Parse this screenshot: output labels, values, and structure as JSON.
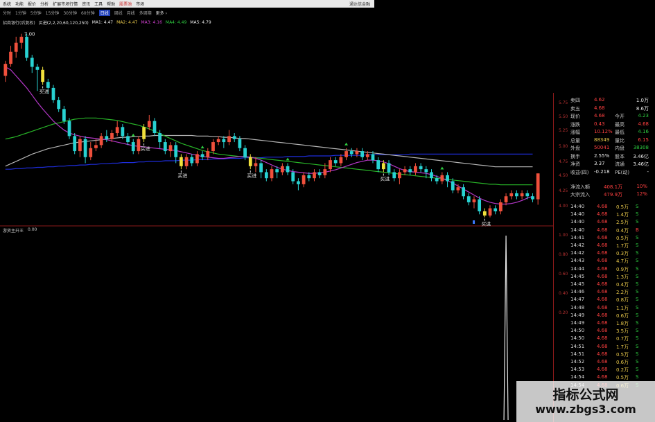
{
  "menu": {
    "items": [
      "系统",
      "功能",
      "报价",
      "分析",
      "扩展市场行情",
      "资讯",
      "工具",
      "帮助",
      "股票池",
      "市场"
    ],
    "hot_index": [
      8
    ],
    "app_name": "通达信金融"
  },
  "periods": {
    "items": [
      "分时",
      "1分钟",
      "5分钟",
      "15分钟",
      "30分钟",
      "60分钟",
      "日线",
      "周线",
      "月线",
      "多周期",
      "更多 ›"
    ],
    "active_index": 6
  },
  "legend": {
    "items": [
      {
        "text": "招商银行(后复权)",
        "color": "#c8c8c8"
      },
      {
        "text": "买进(2,2,20,60,120,250)",
        "color": "#e8e8e8"
      },
      {
        "text": "MA1: 4.47",
        "color": "#e8e8e8"
      },
      {
        "text": "MA2: 4.47",
        "color": "#e8c84a"
      },
      {
        "text": "MA3: 4.16",
        "color": "#d040d0"
      },
      {
        "text": "MA4: 4.49",
        "color": "#2ecc40"
      },
      {
        "text": "MA5: 4.79",
        "color": "#e8e8e8"
      }
    ]
  },
  "price_label": "7.00",
  "sub_indicator": {
    "name": "游资主升王",
    "value": "0.00"
  },
  "buy_label": "买进",
  "colors": {
    "up": "#f0503c",
    "down": "#28d2d2",
    "buy": "#f0e03c",
    "ma_purple": "#b437c8",
    "ma_green": "#28b428",
    "ma_white": "#b4b4b4",
    "ma_blue": "#1e2ddc"
  },
  "quote": [
    {
      "l1": "卖四",
      "v1": "4.62",
      "c1": "#ff4040",
      "l2": "",
      "v2": "1.0万",
      "c2": "#e8e8e8"
    },
    {
      "l1": "卖五",
      "v1": "4.68",
      "c1": "#ff4040",
      "l2": "",
      "v2": "8.6万",
      "c2": "#e8e8e8"
    },
    {
      "l1": "现价",
      "v1": "4.68",
      "c1": "#ff4040",
      "l2": "今开",
      "v2": "4.23",
      "c2": "#2ecc40"
    },
    {
      "l1": "涨跌",
      "v1": "0.43",
      "c1": "#ff4040",
      "l2": "最高",
      "v2": "4.68",
      "c2": "#ff4040"
    },
    {
      "l1": "涨幅",
      "v1": "10.12%",
      "c1": "#ff4040",
      "l2": "最低",
      "v2": "4.16",
      "c2": "#2ecc40"
    },
    {
      "l1": "总量",
      "v1": "88349",
      "c1": "#e8c84a",
      "l2": "量比",
      "v2": "6.15",
      "c2": "#ff4040"
    },
    {
      "l1": "外盘",
      "v1": "50041",
      "c1": "#ff4040",
      "l2": "内盘",
      "v2": "38308",
      "c2": "#2ecc40"
    },
    {
      "l1": "换手",
      "v1": "2.55%",
      "c1": "#e8e8e8",
      "l2": "股本",
      "v2": "3.46亿",
      "c2": "#e8e8e8"
    },
    {
      "l1": "净资",
      "v1": "3.37",
      "c1": "#e8e8e8",
      "l2": "流通",
      "v2": "3.46亿",
      "c2": "#e8e8e8"
    },
    {
      "l1": "收益(四)",
      "v1": "-0.218",
      "c1": "#e8e8e8",
      "l2": "PE(动)",
      "v2": "-",
      "c2": "#e8e8e8"
    }
  ],
  "flow": [
    {
      "l": "净流入额",
      "v": "408.1万",
      "p": "10%"
    },
    {
      "l": "大宗流入",
      "v": "479.9万",
      "p": "12%"
    }
  ],
  "right_axis": [
    "5.75",
    "5.50",
    "5.25",
    "5.00",
    "4.75",
    "4.50",
    "4.25",
    "4.00"
  ],
  "sub_axis": [
    "1.00",
    "0.80",
    "0.60",
    "0.40",
    "0.20"
  ],
  "ticks": [
    {
      "t": "14:40",
      "p": "4.68",
      "v": "0.5万",
      "s": "S"
    },
    {
      "t": "14:40",
      "p": "4.68",
      "v": "1.4万",
      "s": "S"
    },
    {
      "t": "14:40",
      "p": "4.68",
      "v": "2.5万",
      "s": "S"
    },
    {
      "t": "14:40",
      "p": "4.68",
      "v": "0.4万",
      "s": "B"
    },
    {
      "t": "14:41",
      "p": "4.68",
      "v": "0.5万",
      "s": "S"
    },
    {
      "t": "14:42",
      "p": "4.68",
      "v": "1.7万",
      "s": "S"
    },
    {
      "t": "14:42",
      "p": "4.68",
      "v": "0.3万",
      "s": "S"
    },
    {
      "t": "14:43",
      "p": "4.68",
      "v": "4.7万",
      "s": "S"
    },
    {
      "t": "14:44",
      "p": "4.68",
      "v": "0.9万",
      "s": "S"
    },
    {
      "t": "14:45",
      "p": "4.68",
      "v": "1.3万",
      "s": "S"
    },
    {
      "t": "14:45",
      "p": "4.68",
      "v": "0.4万",
      "s": "S"
    },
    {
      "t": "14:46",
      "p": "4.68",
      "v": "2.2万",
      "s": "S"
    },
    {
      "t": "14:47",
      "p": "4.68",
      "v": "0.8万",
      "s": "S"
    },
    {
      "t": "14:48",
      "p": "4.68",
      "v": "1.1万",
      "s": "S"
    },
    {
      "t": "14:49",
      "p": "4.68",
      "v": "0.6万",
      "s": "S"
    },
    {
      "t": "14:49",
      "p": "4.68",
      "v": "1.8万",
      "s": "S"
    },
    {
      "t": "14:50",
      "p": "4.68",
      "v": "3.5万",
      "s": "S"
    },
    {
      "t": "14:50",
      "p": "4.68",
      "v": "0.7万",
      "s": "S"
    },
    {
      "t": "14:51",
      "p": "4.68",
      "v": "1.7万",
      "s": "S"
    },
    {
      "t": "14:51",
      "p": "4.68",
      "v": "0.5万",
      "s": "S"
    },
    {
      "t": "14:52",
      "p": "4.68",
      "v": "0.6万",
      "s": "S"
    },
    {
      "t": "14:53",
      "p": "4.68",
      "v": "0.2万",
      "s": "S"
    },
    {
      "t": "14:54",
      "p": "4.68",
      "v": "0.5万",
      "s": "S"
    },
    {
      "t": "14:54",
      "p": "4.68",
      "v": "0.6万",
      "s": "S"
    }
  ],
  "chart_data": {
    "type": "candlestick",
    "y_axis_labels": [
      "5.75",
      "5.50",
      "5.25",
      "5.00",
      "4.75",
      "4.50",
      "4.25",
      "4.00"
    ],
    "ylim": [
      3.9,
      7.1
    ],
    "candles": [
      {
        "o": 6.3,
        "c": 6.5,
        "h": 6.55,
        "l": 6.2
      },
      {
        "o": 6.5,
        "c": 6.7,
        "h": 6.8,
        "l": 6.45
      },
      {
        "o": 6.7,
        "c": 6.85,
        "h": 6.95,
        "l": 6.6
      },
      {
        "o": 6.85,
        "c": 6.95,
        "h": 7.0,
        "l": 6.75
      },
      {
        "o": 6.95,
        "c": 6.6,
        "h": 7.0,
        "l": 6.55
      },
      {
        "o": 6.6,
        "c": 6.45,
        "h": 6.65,
        "l": 6.35
      },
      {
        "o": 6.45,
        "c": 6.4,
        "h": 6.5,
        "l": 6.05
      },
      {
        "o": 6.4,
        "c": 6.2,
        "h": 6.45,
        "l": 6.15
      },
      {
        "o": 6.2,
        "c": 6.1,
        "h": 6.25,
        "l": 6.0
      },
      {
        "o": 6.1,
        "c": 5.9,
        "h": 6.15,
        "l": 5.85
      },
      {
        "o": 5.9,
        "c": 5.75,
        "h": 5.95,
        "l": 5.7
      },
      {
        "o": 5.75,
        "c": 5.55,
        "h": 5.8,
        "l": 5.5
      },
      {
        "o": 5.55,
        "c": 5.3,
        "h": 5.6,
        "l": 5.25
      },
      {
        "o": 5.3,
        "c": 5.05,
        "h": 5.35,
        "l": 5.0
      },
      {
        "o": 5.05,
        "c": 5.25,
        "h": 5.3,
        "l": 4.95
      },
      {
        "o": 5.25,
        "c": 4.95,
        "h": 5.3,
        "l": 4.85
      },
      {
        "o": 4.95,
        "c": 5.1,
        "h": 5.2,
        "l": 4.9
      },
      {
        "o": 5.1,
        "c": 5.15,
        "h": 5.25,
        "l": 5.05
      },
      {
        "o": 5.15,
        "c": 5.3,
        "h": 5.35,
        "l": 5.1
      },
      {
        "o": 5.3,
        "c": 5.25,
        "h": 5.4,
        "l": 5.2
      },
      {
        "o": 5.25,
        "c": 5.35,
        "h": 5.4,
        "l": 5.2
      },
      {
        "o": 5.35,
        "c": 5.45,
        "h": 5.55,
        "l": 5.3
      },
      {
        "o": 5.45,
        "c": 5.3,
        "h": 5.5,
        "l": 5.25
      },
      {
        "o": 5.3,
        "c": 5.2,
        "h": 5.35,
        "l": 5.15
      },
      {
        "o": 5.2,
        "c": 5.05,
        "h": 5.25,
        "l": 5.0
      },
      {
        "o": 5.05,
        "c": 5.25,
        "h": 5.3,
        "l": 5.0
      },
      {
        "o": 5.25,
        "c": 5.45,
        "h": 5.5,
        "l": 5.2
      },
      {
        "o": 5.45,
        "c": 5.55,
        "h": 5.65,
        "l": 5.4
      },
      {
        "o": 5.55,
        "c": 5.35,
        "h": 5.6,
        "l": 5.3
      },
      {
        "o": 5.35,
        "c": 5.2,
        "h": 5.4,
        "l": 5.1
      },
      {
        "o": 5.2,
        "c": 5.05,
        "h": 5.25,
        "l": 5.0
      },
      {
        "o": 5.05,
        "c": 5.15,
        "h": 5.2,
        "l": 4.95
      },
      {
        "o": 5.15,
        "c": 4.95,
        "h": 5.2,
        "l": 4.85
      },
      {
        "o": 4.95,
        "c": 4.8,
        "h": 5.0,
        "l": 4.75
      },
      {
        "o": 4.8,
        "c": 4.95,
        "h": 5.0,
        "l": 4.75
      },
      {
        "o": 4.95,
        "c": 4.85,
        "h": 5.0,
        "l": 4.8
      },
      {
        "o": 4.85,
        "c": 5.0,
        "h": 5.05,
        "l": 4.8
      },
      {
        "o": 5.0,
        "c": 4.95,
        "h": 5.05,
        "l": 4.9
      },
      {
        "o": 4.95,
        "c": 5.05,
        "h": 5.1,
        "l": 4.9
      },
      {
        "o": 5.05,
        "c": 5.2,
        "h": 5.25,
        "l": 5.0
      },
      {
        "o": 5.2,
        "c": 5.25,
        "h": 5.3,
        "l": 5.15
      },
      {
        "o": 5.25,
        "c": 5.2,
        "h": 5.3,
        "l": 5.1
      },
      {
        "o": 5.2,
        "c": 5.3,
        "h": 5.4,
        "l": 5.15
      },
      {
        "o": 5.3,
        "c": 5.25,
        "h": 5.35,
        "l": 5.2
      },
      {
        "o": 5.25,
        "c": 5.1,
        "h": 5.3,
        "l": 5.05
      },
      {
        "o": 5.1,
        "c": 4.95,
        "h": 5.15,
        "l": 4.9
      },
      {
        "o": 4.95,
        "c": 4.8,
        "h": 5.0,
        "l": 4.75
      },
      {
        "o": 4.8,
        "c": 4.85,
        "h": 4.95,
        "l": 4.7
      },
      {
        "o": 4.85,
        "c": 4.7,
        "h": 4.9,
        "l": 4.6
      },
      {
        "o": 4.7,
        "c": 4.6,
        "h": 4.75,
        "l": 4.55
      },
      {
        "o": 4.6,
        "c": 4.75,
        "h": 4.8,
        "l": 4.55
      },
      {
        "o": 4.75,
        "c": 4.7,
        "h": 4.8,
        "l": 4.6
      },
      {
        "o": 4.7,
        "c": 4.8,
        "h": 4.85,
        "l": 4.65
      },
      {
        "o": 4.8,
        "c": 4.7,
        "h": 4.85,
        "l": 4.65
      },
      {
        "o": 4.7,
        "c": 4.55,
        "h": 4.75,
        "l": 4.5
      },
      {
        "o": 4.55,
        "c": 4.5,
        "h": 4.6,
        "l": 4.4
      },
      {
        "o": 4.5,
        "c": 4.65,
        "h": 4.7,
        "l": 4.45
      },
      {
        "o": 4.65,
        "c": 4.6,
        "h": 4.7,
        "l": 4.55
      },
      {
        "o": 4.6,
        "c": 4.7,
        "h": 4.75,
        "l": 4.55
      },
      {
        "o": 4.7,
        "c": 4.65,
        "h": 4.75,
        "l": 4.6
      },
      {
        "o": 4.65,
        "c": 4.75,
        "h": 4.85,
        "l": 4.6
      },
      {
        "o": 4.75,
        "c": 4.9,
        "h": 4.95,
        "l": 4.7
      },
      {
        "o": 4.9,
        "c": 4.85,
        "h": 4.95,
        "l": 4.8
      },
      {
        "o": 4.85,
        "c": 4.95,
        "h": 5.0,
        "l": 4.8
      },
      {
        "o": 4.95,
        "c": 5.05,
        "h": 5.1,
        "l": 4.9
      },
      {
        "o": 5.05,
        "c": 5.0,
        "h": 5.1,
        "l": 4.95
      },
      {
        "o": 5.0,
        "c": 5.05,
        "h": 5.1,
        "l": 4.95
      },
      {
        "o": 5.05,
        "c": 4.95,
        "h": 5.1,
        "l": 4.9
      },
      {
        "o": 4.95,
        "c": 5.0,
        "h": 5.05,
        "l": 4.9
      },
      {
        "o": 5.0,
        "c": 4.9,
        "h": 5.05,
        "l": 4.85
      },
      {
        "o": 4.9,
        "c": 4.75,
        "h": 4.95,
        "l": 4.7
      },
      {
        "o": 4.75,
        "c": 4.85,
        "h": 4.9,
        "l": 4.7
      },
      {
        "o": 4.85,
        "c": 4.7,
        "h": 4.9,
        "l": 4.65
      },
      {
        "o": 4.7,
        "c": 4.6,
        "h": 4.75,
        "l": 4.55
      },
      {
        "o": 4.6,
        "c": 4.7,
        "h": 4.75,
        "l": 4.5
      },
      {
        "o": 4.7,
        "c": 4.75,
        "h": 4.8,
        "l": 4.65
      },
      {
        "o": 4.75,
        "c": 4.7,
        "h": 4.8,
        "l": 4.65
      },
      {
        "o": 4.7,
        "c": 4.8,
        "h": 4.85,
        "l": 4.65
      },
      {
        "o": 4.8,
        "c": 4.75,
        "h": 4.85,
        "l": 4.7
      },
      {
        "o": 4.75,
        "c": 4.7,
        "h": 4.8,
        "l": 4.6
      },
      {
        "o": 4.7,
        "c": 4.6,
        "h": 4.75,
        "l": 4.55
      },
      {
        "o": 4.6,
        "c": 4.55,
        "h": 4.65,
        "l": 4.5
      },
      {
        "o": 4.55,
        "c": 4.65,
        "h": 4.7,
        "l": 4.5
      },
      {
        "o": 4.65,
        "c": 4.55,
        "h": 4.7,
        "l": 4.45
      },
      {
        "o": 4.55,
        "c": 4.4,
        "h": 4.6,
        "l": 4.35
      },
      {
        "o": 4.4,
        "c": 4.45,
        "h": 4.5,
        "l": 4.35
      },
      {
        "o": 4.45,
        "c": 4.3,
        "h": 4.5,
        "l": 4.25
      },
      {
        "o": 4.3,
        "c": 4.2,
        "h": 4.35,
        "l": 4.15
      },
      {
        "o": 4.2,
        "c": 4.25,
        "h": 4.3,
        "l": 4.1
      },
      {
        "o": 4.25,
        "c": 4.05,
        "h": 4.3,
        "l": 4.0
      },
      {
        "o": 4.05,
        "c": 3.98,
        "h": 4.1,
        "l": 3.95
      },
      {
        "o": 3.98,
        "c": 4.1,
        "h": 4.15,
        "l": 3.95
      },
      {
        "o": 4.1,
        "c": 4.05,
        "h": 4.15,
        "l": 4.0
      },
      {
        "o": 4.05,
        "c": 4.2,
        "h": 4.25,
        "l": 4.0
      },
      {
        "o": 4.2,
        "c": 4.3,
        "h": 4.35,
        "l": 4.15
      },
      {
        "o": 4.3,
        "c": 4.35,
        "h": 4.4,
        "l": 4.25
      },
      {
        "o": 4.35,
        "c": 4.3,
        "h": 4.4,
        "l": 4.25
      },
      {
        "o": 4.3,
        "c": 4.35,
        "h": 4.4,
        "l": 4.25
      },
      {
        "o": 4.35,
        "c": 4.3,
        "h": 4.4,
        "l": 4.25
      },
      {
        "o": 4.3,
        "c": 4.25,
        "h": 4.35,
        "l": 4.2
      },
      {
        "o": 4.25,
        "c": 4.68,
        "h": 4.68,
        "l": 4.16
      }
    ],
    "buy_signals": [
      7,
      26,
      33,
      46,
      71,
      90
    ],
    "arrows": [
      24,
      37,
      53,
      64,
      82
    ],
    "ma_purple": [
      6.45,
      6.4,
      6.3,
      6.2,
      6.1,
      5.98,
      5.86,
      5.75,
      5.65,
      5.55,
      5.47,
      5.4,
      5.35,
      5.32,
      5.3,
      5.28,
      5.27,
      5.26,
      5.25,
      5.24,
      5.22,
      5.2,
      5.18,
      5.16,
      5.14,
      5.13,
      5.12,
      5.11,
      5.1,
      5.09,
      5.08,
      5.07,
      5.06,
      5.04,
      5.02,
      5.0,
      4.98,
      4.96,
      4.95,
      4.94,
      4.93,
      4.93,
      4.94,
      4.95,
      4.96,
      4.96,
      4.95,
      4.93,
      4.9,
      4.86,
      4.82,
      4.78,
      4.75,
      4.73,
      4.71,
      4.7,
      4.69,
      4.68,
      4.68,
      4.69,
      4.7,
      4.72,
      4.74,
      4.77,
      4.8,
      4.83,
      4.86,
      4.88,
      4.9,
      4.9,
      4.89,
      4.87,
      4.84,
      4.8,
      4.76,
      4.73,
      4.71,
      4.7,
      4.69,
      4.68,
      4.66,
      4.63,
      4.6,
      4.56,
      4.52,
      4.47,
      4.42,
      4.37,
      4.32,
      4.27,
      4.23,
      4.2,
      4.18,
      4.17,
      4.17,
      4.18,
      4.2,
      4.23,
      4.27,
      4.3
    ],
    "ma_green": [
      5.25,
      5.27,
      5.29,
      5.32,
      5.35,
      5.38,
      5.41,
      5.44,
      5.47,
      5.5,
      5.52,
      5.54,
      5.56,
      5.58,
      5.59,
      5.6,
      5.6,
      5.6,
      5.59,
      5.58,
      5.57,
      5.56,
      5.54,
      5.52,
      5.5,
      5.48,
      5.45,
      5.42,
      5.38,
      5.34,
      5.3,
      5.26,
      5.22,
      5.18,
      5.15,
      5.12,
      5.09,
      5.06,
      5.04,
      5.02,
      5.0,
      4.99,
      4.98,
      4.97,
      4.96,
      4.95,
      4.95,
      4.94,
      4.93,
      4.92,
      4.91,
      4.9,
      4.89,
      4.88,
      4.87,
      4.86,
      4.85,
      4.84,
      4.83,
      4.82,
      4.81,
      4.8,
      4.79,
      4.78,
      4.77,
      4.76,
      4.75,
      4.74,
      4.73,
      4.72,
      4.71,
      4.7,
      4.69,
      4.68,
      4.67,
      4.66,
      4.65,
      4.64,
      4.63,
      4.62,
      4.61,
      4.6,
      4.59,
      4.58,
      4.57,
      4.56,
      4.55,
      4.54,
      4.53,
      4.52,
      4.51,
      4.5,
      4.5,
      4.49,
      4.49,
      4.49,
      4.49,
      4.49,
      4.49,
      4.49
    ],
    "ma_white": [
      4.8,
      4.84,
      4.88,
      4.92,
      4.96,
      5.0,
      5.03,
      5.06,
      5.09,
      5.11,
      5.13,
      5.15,
      5.17,
      5.19,
      5.2,
      5.21,
      5.22,
      5.23,
      5.24,
      5.25,
      5.26,
      5.27,
      5.28,
      5.28,
      5.29,
      5.29,
      5.3,
      5.3,
      5.31,
      5.31,
      5.31,
      5.31,
      5.31,
      5.31,
      5.31,
      5.31,
      5.3,
      5.3,
      5.3,
      5.29,
      5.29,
      5.28,
      5.28,
      5.27,
      5.26,
      5.26,
      5.25,
      5.24,
      5.23,
      5.22,
      5.21,
      5.2,
      5.19,
      5.18,
      5.17,
      5.16,
      5.15,
      5.14,
      5.13,
      5.12,
      5.11,
      5.1,
      5.09,
      5.08,
      5.07,
      5.06,
      5.05,
      5.04,
      5.03,
      5.02,
      5.01,
      5.0,
      4.99,
      4.98,
      4.97,
      4.96,
      4.95,
      4.94,
      4.93,
      4.92,
      4.91,
      4.9,
      4.89,
      4.88,
      4.87,
      4.86,
      4.85,
      4.84,
      4.83,
      4.82,
      4.81,
      4.8,
      4.79,
      4.79,
      4.79,
      4.79,
      4.79,
      4.79,
      4.79,
      4.79
    ],
    "ma_blue": [
      4.75,
      4.75,
      4.76,
      4.76,
      4.77,
      4.77,
      4.78,
      4.78,
      4.79,
      4.79,
      4.8,
      4.8,
      4.81,
      4.81,
      4.82,
      4.82,
      4.83,
      4.83,
      4.84,
      4.84,
      4.85,
      4.85,
      4.86,
      4.86,
      4.86,
      4.87,
      4.87,
      4.88,
      4.88,
      4.88,
      4.89,
      4.89,
      4.89,
      4.9,
      4.9,
      4.9,
      4.91,
      4.91,
      4.91,
      4.92,
      4.92,
      4.92,
      4.93,
      4.93,
      4.93,
      4.94,
      4.94,
      4.94,
      4.94,
      4.95,
      4.95,
      4.95,
      4.95,
      4.96,
      4.96,
      4.96,
      4.96,
      4.97,
      4.97,
      4.97,
      4.97,
      4.97,
      4.98,
      4.98,
      4.98,
      4.98,
      4.98,
      4.98,
      4.99,
      4.99,
      4.99,
      4.99,
      4.99,
      4.99,
      4.99,
      4.99,
      5.0,
      5.0,
      5.0,
      5.0,
      5.0,
      5.0,
      5.0,
      5.0,
      5.0,
      5.0,
      5.0,
      5.0,
      5.0,
      5.0,
      5.0,
      5.0,
      5.0,
      5.0,
      5.0,
      5.0,
      5.0,
      5.0,
      5.0,
      5.0
    ],
    "sub_series": {
      "name": "游资主升王",
      "spike_index": 94,
      "spike_value": 1.0
    }
  },
  "watermark": {
    "title": "指标公式网",
    "url": "www.zbgs3.com"
  }
}
